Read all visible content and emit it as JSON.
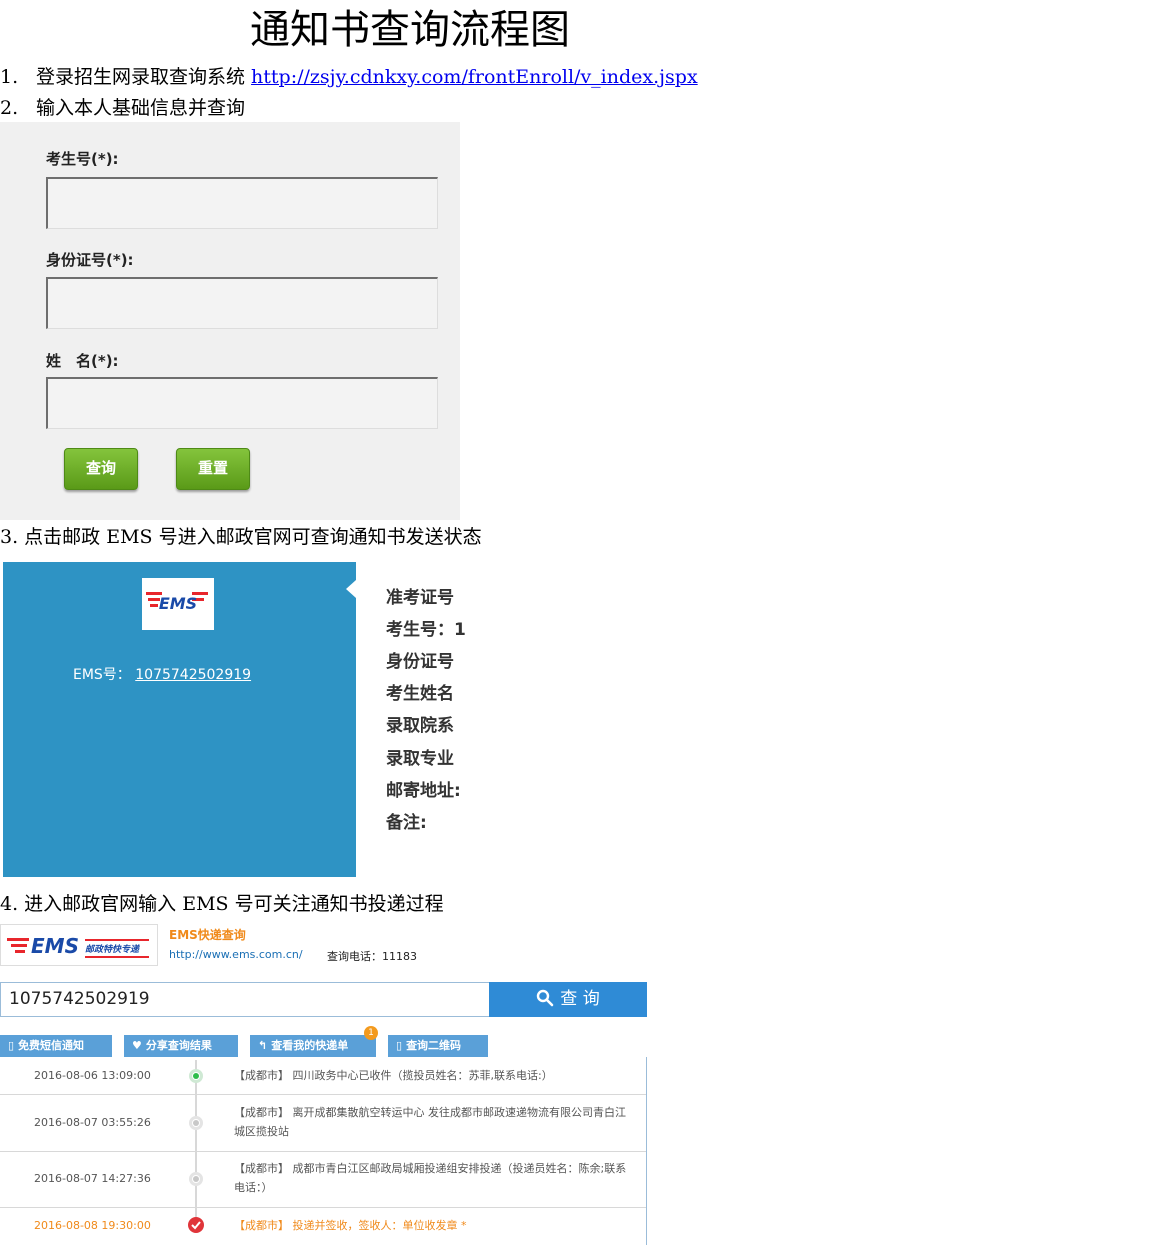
{
  "title": "通知书查询流程图",
  "steps": {
    "s1_num": "1.",
    "s1_text": "登录招生网录取查询系统 ",
    "s1_link": "http://zsjy.cdnkxy.com/frontEnroll/v_index.jspx",
    "s2_num": "2.",
    "s2_text": "输入本人基础信息并查询",
    "s3": "3.  点击邮政 EMS 号进入邮政官网可查询通知书发送状态",
    "s4": "4.  进入邮政官网输入 EMS 号可关注通知书投递过程"
  },
  "form": {
    "exam_no_label": "考生号(*):",
    "id_label": "身份证号(*):",
    "name_label": "姓　名(*):",
    "query_button": "查询",
    "reset_button": "重置"
  },
  "ems_card": {
    "logo_text": "EMS",
    "ems_label": "EMS号：",
    "ems_number": "1075742502919",
    "fields": [
      "准考证号",
      "考生号：1",
      "身份证号",
      "考生姓名",
      "录取院系",
      "录取专业",
      "邮寄地址:",
      "备注:"
    ]
  },
  "tracking": {
    "logo_text": "EMS",
    "logo_sub": "邮政特快专递",
    "site_name": "EMS快递查询",
    "site_url": "http://www.ems.com.cn/",
    "tel": "查询电话：11183",
    "search_value": "1075742502919",
    "search_button": "查 询",
    "tabs": [
      "免费短信通知",
      "分享查询结果",
      "查看我的快递单",
      "查询二维码"
    ],
    "badge": "1",
    "events": [
      {
        "time": "2016-08-06 13:09:00",
        "desc": "【成都市】 四川政务中心已收件（揽投员姓名：苏菲,联系电话:）"
      },
      {
        "time": "2016-08-07 03:55:26",
        "desc": "【成都市】 离开成都集散航空转运中心 发往成都市邮政速递物流有限公司青白江城区揽投站"
      },
      {
        "time": "2016-08-07 14:27:36",
        "desc": "【成都市】 成都市青白江区邮政局城厢投递组安排投递（投递员姓名：陈余;联系电话：）"
      },
      {
        "time": "2016-08-08 19:30:00",
        "desc": "【成都市】 投递并签收，签收人：单位收发章 *"
      }
    ],
    "colors": {
      "accent_blue": "#2f8bd6",
      "orange": "#f08a1b",
      "green": "#2ebd4a",
      "red": "#e0353a"
    }
  }
}
